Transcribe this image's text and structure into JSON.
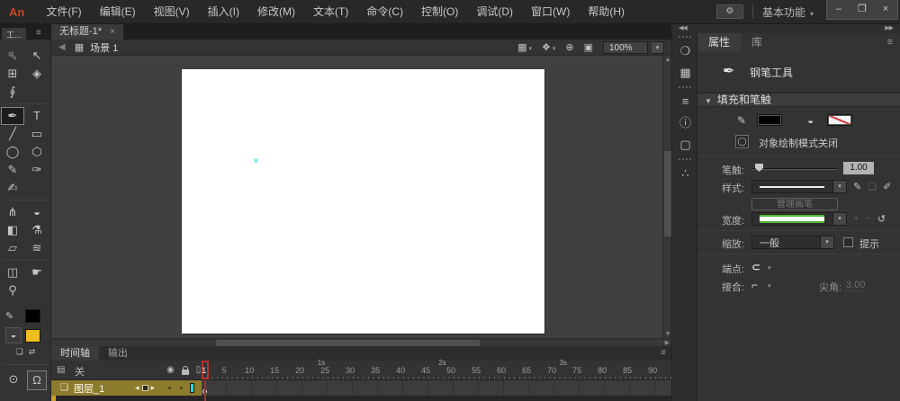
{
  "app": {
    "logo_text": "An",
    "logo_color": "#c4472e"
  },
  "menubar": {
    "items": [
      {
        "name": "file",
        "label": "文件(F)"
      },
      {
        "name": "edit",
        "label": "编辑(E)"
      },
      {
        "name": "view",
        "label": "视图(V)"
      },
      {
        "name": "insert",
        "label": "插入(I)"
      },
      {
        "name": "modify",
        "label": "修改(M)"
      },
      {
        "name": "text",
        "label": "文本(T)"
      },
      {
        "name": "commands",
        "label": "命令(C)"
      },
      {
        "name": "control",
        "label": "控制(O)"
      },
      {
        "name": "debug",
        "label": "调试(D)"
      },
      {
        "name": "window",
        "label": "窗口(W)"
      },
      {
        "name": "help",
        "label": "帮助(H)"
      }
    ],
    "sync_glyph": "⚙",
    "workspace_label": "基本功能",
    "workspace_caret": "▾",
    "window_controls": [
      {
        "name": "minimize",
        "glyph": "–"
      },
      {
        "name": "restore",
        "glyph": "❐"
      },
      {
        "name": "close",
        "glyph": "×"
      }
    ]
  },
  "document_tab": {
    "title": "无标题-1*",
    "close_glyph": "×"
  },
  "tools_panel": {
    "title": "工...",
    "menu_glyph": "≡",
    "tools": [
      {
        "name": "subselection-tool",
        "glyph": "↖",
        "hollow": true
      },
      {
        "name": "selection-tool",
        "glyph": "↖"
      },
      {
        "name": "free-transform-tool",
        "glyph": "⊞"
      },
      {
        "name": "gradient-transform-tool",
        "glyph": "◈"
      },
      {
        "name": "lasso-tool",
        "glyph": "∮"
      },
      {
        "empty": true
      },
      {
        "divider": true
      },
      {
        "name": "pen-tool",
        "glyph": "✒",
        "selected": true
      },
      {
        "name": "text-tool",
        "glyph": "T"
      },
      {
        "name": "line-tool",
        "glyph": "╱"
      },
      {
        "name": "rectangle-tool",
        "glyph": "▭"
      },
      {
        "name": "oval-tool",
        "glyph": "◯"
      },
      {
        "name": "polystar-tool",
        "glyph": "⬡"
      },
      {
        "name": "pencil-tool",
        "glyph": "✎"
      },
      {
        "name": "brush-tool",
        "glyph": "✑"
      },
      {
        "name": "paint-brush-tool",
        "glyph": "✍"
      },
      {
        "empty": true
      },
      {
        "divider": true
      },
      {
        "name": "bone-tool",
        "glyph": "⋔"
      },
      {
        "name": "paint-bucket-tool",
        "glyph": "◒"
      },
      {
        "name": "ink-bottle-tool",
        "glyph": "◧"
      },
      {
        "name": "eyedropper-tool",
        "glyph": "⚗"
      },
      {
        "name": "eraser-tool",
        "glyph": "▱"
      },
      {
        "name": "width-tool",
        "glyph": "≋"
      },
      {
        "divider": true
      },
      {
        "name": "camera-tool",
        "glyph": "◫"
      },
      {
        "name": "hand-tool",
        "glyph": "☛"
      },
      {
        "name": "zoom-tool",
        "glyph": "⚲"
      },
      {
        "empty": true
      }
    ],
    "stroke_icon": "✎",
    "stroke_swatch": "#000000",
    "fill_icon": "◒",
    "fill_swatch": "#eec01f",
    "small_controls": [
      {
        "name": "default-colors",
        "glyph": "❏"
      },
      {
        "name": "swap-colors",
        "glyph": "⇄"
      }
    ],
    "bottom_tools": [
      {
        "name": "object-drawing-toggle",
        "glyph": "⊙",
        "active": false
      },
      {
        "name": "snap-to-objects-toggle",
        "glyph": "Ω",
        "active": true
      }
    ]
  },
  "stage": {
    "back_glyph": "◀",
    "scene_icon_glyph": "▦",
    "scene_label": "场景 1",
    "controls": [
      {
        "name": "edit-scene",
        "glyph": "▦",
        "caret": "▾"
      },
      {
        "name": "edit-symbols",
        "glyph": "❖",
        "caret": "▾"
      },
      {
        "name": "center-frame",
        "glyph": "⊕",
        "caret": ""
      },
      {
        "name": "clip-content",
        "glyph": "▣",
        "caret": ""
      }
    ],
    "zoom_value": "100%",
    "zoom_caret": "▾",
    "anchor_color": "#8df3ec",
    "scroll_arrows": {
      "up": "▲",
      "down": "▼",
      "right": "▶"
    }
  },
  "timeline": {
    "tabs": [
      {
        "name": "timeline",
        "label": "时间轴",
        "active": true
      },
      {
        "name": "output",
        "label": "输出",
        "active": false
      }
    ],
    "panel_menu_glyph": "≡",
    "parent_view": {
      "icon_glyph": "▤",
      "label": "关"
    },
    "column_icons": [
      {
        "name": "show-hide-column-icon",
        "glyph": "◉"
      },
      {
        "name": "lock-column-icon",
        "glyph": ""
      },
      {
        "name": "outline-column-icon",
        "glyph": "▯"
      }
    ],
    "layer": {
      "icon_glyph": "❏",
      "name_label": "图层_1",
      "controls": [
        {
          "name": "layer-prev",
          "glyph": "◂"
        },
        {
          "name": "layer-marker",
          "glyph": ""
        },
        {
          "name": "layer-next",
          "glyph": "▸"
        }
      ],
      "outline_color": "#29d8dc"
    },
    "ruler": {
      "numbers": [
        1,
        5,
        10,
        15,
        20,
        25,
        30,
        35,
        40,
        45,
        50,
        55,
        60,
        65,
        70,
        75,
        80,
        85,
        90
      ],
      "frame_width": 5.6,
      "seconds": [
        {
          "label": "1s",
          "frame": 24
        },
        {
          "label": "2s",
          "frame": 48
        },
        {
          "label": "3s",
          "frame": 72
        }
      ],
      "playhead_frame": 1,
      "playhead_color": "#b73431"
    }
  },
  "dock": {
    "collapse_left": "◀◀",
    "collapse_right": "▶▶",
    "items": [
      {
        "name": "color-panel",
        "glyph": "❍",
        "group_start": true
      },
      {
        "name": "swatches-panel",
        "glyph": "▦"
      },
      {
        "name": "align-panel",
        "glyph": "≡",
        "group_start": true
      },
      {
        "name": "info-panel",
        "glyph": "ⓘ"
      },
      {
        "name": "transform-panel",
        "glyph": "▢"
      },
      {
        "name": "motion-presets-panel",
        "glyph": "∴",
        "group_start": true
      }
    ]
  },
  "properties": {
    "tabs": [
      {
        "name": "properties",
        "label": "属性",
        "active": true
      },
      {
        "name": "library",
        "label": "库",
        "active": false
      }
    ],
    "panel_menu_glyph": "≡",
    "tool_icon_glyph": "✒",
    "tool_name": "钢笔工具",
    "section": {
      "caret": "▼",
      "title": "填充和笔触"
    },
    "stroke_color_icon": "✎",
    "stroke_color": "#000000",
    "fill_color_icon": "◒",
    "object_drawing": {
      "icon_glyph": "◯",
      "label": "对象绘制模式关闭"
    },
    "stroke_row": {
      "label": "笔触:",
      "value": "1.00"
    },
    "style_row": {
      "label": "样式:",
      "icons": [
        {
          "name": "edit-stroke-style",
          "glyph": "✎",
          "disabled": false
        },
        {
          "name": "stroke-style-copy",
          "glyph": "❏",
          "disabled": true
        },
        {
          "name": "brush-library",
          "glyph": "✐",
          "disabled": false
        }
      ]
    },
    "manage_brushes_label": "管理画笔",
    "width_row": {
      "label": "宽度:",
      "icons": [
        {
          "name": "add-width-profile",
          "glyph": "+",
          "disabled": true
        },
        {
          "name": "delete-width-profile",
          "glyph": "−",
          "disabled": true
        },
        {
          "name": "reset-width-profile",
          "glyph": "↺",
          "disabled": false
        }
      ]
    },
    "scale_row": {
      "label": "缩放:",
      "value": "一般",
      "caret": "▾",
      "hint_label": "提示"
    },
    "cap_row": {
      "label": "端点:",
      "icon_glyph": "⊂",
      "caret": "▾"
    },
    "join_row": {
      "label": "接合:",
      "icon_glyph": "⌐",
      "caret": "▾",
      "miter_label": "尖角:",
      "miter_value": "3.00"
    }
  }
}
